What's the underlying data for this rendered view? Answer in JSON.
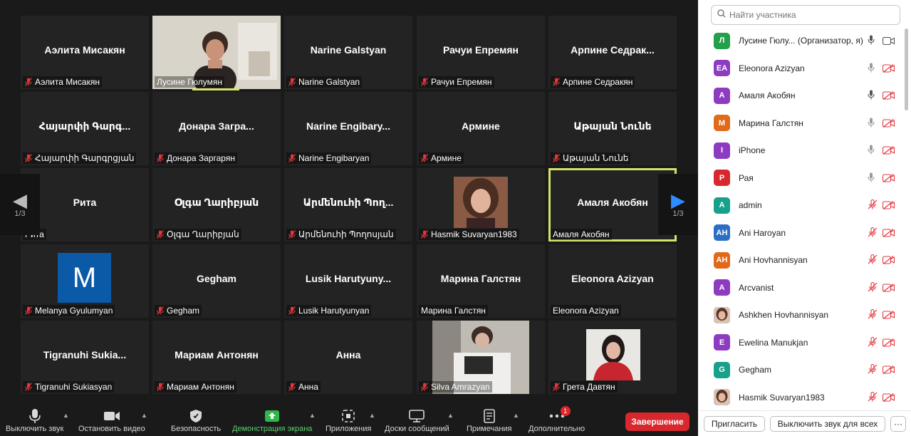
{
  "tiles": [
    {
      "big": "Аэлита Мисакян",
      "label": "Аэлита Мисакян",
      "muted": true
    },
    {
      "big": "",
      "label": "Лусине Гюлумян",
      "muted": false,
      "video": "woman-room"
    },
    {
      "big": "Narine Galstyan",
      "label": "Narine Galstyan",
      "muted": true
    },
    {
      "big": "Рачуи Епремян",
      "label": "Рачуи Епремян",
      "muted": true
    },
    {
      "big": "Арпине Седрак...",
      "label": "Арпине Седракян",
      "muted": true
    },
    {
      "big": "Հայարփի Գարգ...",
      "label": "Հայարփի Գարգրցյան",
      "muted": true
    },
    {
      "big": "Донара Загра...",
      "label": "Донара Заргарян",
      "muted": true
    },
    {
      "big": "Narine Engibary...",
      "label": "Narine Engibaryan",
      "muted": true
    },
    {
      "big": "Армине",
      "label": "Армине",
      "muted": true
    },
    {
      "big": "Աթայան Նունե",
      "label": "Աթայան Նունե",
      "muted": true
    },
    {
      "big": "Рита",
      "label": "Рита",
      "muted": false
    },
    {
      "big": "Օլգա Ղարիբյան",
      "label": "Օլգա Ղարիբյան",
      "muted": true
    },
    {
      "big": "Արմենուհի Պող...",
      "label": "Արմենուհի Պողոսյան",
      "muted": true
    },
    {
      "big": "",
      "label": "Hasmik Suvaryan1983",
      "muted": true,
      "video": "portrait"
    },
    {
      "big": "Амаля Акобян",
      "label": "Амаля Акобян",
      "muted": false,
      "active": true
    },
    {
      "big": "",
      "label": "Melanya Gyulumyan",
      "muted": true,
      "avatar": "M"
    },
    {
      "big": "Gegham",
      "label": "Gegham",
      "muted": true
    },
    {
      "big": "Lusik Harutyuny...",
      "label": "Lusik Harutyunyan",
      "muted": true
    },
    {
      "big": "Марина Галстян",
      "label": "Марина Галстян",
      "muted": false
    },
    {
      "big": "Eleonora Azizyan",
      "label": "Eleonora Azizyan",
      "muted": false
    },
    {
      "big": "Tigranuhi Sukia...",
      "label": "Tigranuhi Sukiasyan",
      "muted": true
    },
    {
      "big": "Мариам Антонян",
      "label": "Мариам Антонян",
      "muted": true
    },
    {
      "big": "Анна",
      "label": "Анна",
      "muted": true
    },
    {
      "big": "",
      "label": "Silva Amrazyan",
      "muted": true,
      "video": "desk"
    },
    {
      "big": "",
      "label": "Грета Давтян",
      "muted": true,
      "video": "red"
    }
  ],
  "pager": {
    "left": "1/3",
    "right": "1/3"
  },
  "toolbar": {
    "mute": "Выключить звук",
    "video": "Остановить видео",
    "security": "Безопасность",
    "share": "Демонстрация экрана",
    "apps": "Приложения",
    "whiteboards": "Доски сообщений",
    "notes": "Примечания",
    "more": "Дополнительно",
    "more_badge": "1",
    "end": "Завершение"
  },
  "panel": {
    "search_placeholder": "Найти участника",
    "invite": "Пригласить",
    "mute_all": "Выключить звук для всех",
    "more": "···"
  },
  "participants": [
    {
      "initials": "Л",
      "color": "#22a04a",
      "name": "Лусине Гюлу...  (Организатор, я)",
      "mic": "on",
      "cam": "on"
    },
    {
      "initials": "EA",
      "color": "#8d3bc1",
      "name": "Eleonora Azizyan",
      "mic": "on-gray",
      "cam": "off"
    },
    {
      "initials": "A",
      "color": "#8d3bc1",
      "name": "Амаля Акобян",
      "mic": "on",
      "cam": "off"
    },
    {
      "initials": "M",
      "color": "#e06a1a",
      "name": "Марина Галстян",
      "mic": "on-gray",
      "cam": "off"
    },
    {
      "initials": "I",
      "color": "#8d3bc1",
      "name": "iPhone",
      "mic": "on-gray",
      "cam": "off"
    },
    {
      "initials": "P",
      "color": "#d8282e",
      "name": "Рая",
      "mic": "on-gray",
      "cam": "off"
    },
    {
      "initials": "A",
      "color": "#18a08a",
      "name": "admin",
      "mic": "off",
      "cam": "off"
    },
    {
      "initials": "AH",
      "color": "#2a6fc4",
      "name": "Ani Haroyan",
      "mic": "off",
      "cam": "off"
    },
    {
      "initials": "AH",
      "color": "#e06a1a",
      "name": "Ani Hovhannisyan",
      "mic": "off",
      "cam": "off"
    },
    {
      "initials": "A",
      "color": "#8d3bc1",
      "name": "Arcvanist",
      "mic": "off",
      "cam": "off"
    },
    {
      "initials": "",
      "color": "#7a4a3a",
      "name": "Ashkhen Hovhannisyan",
      "mic": "off",
      "cam": "off",
      "photo": true
    },
    {
      "initials": "E",
      "color": "#8d3bc1",
      "name": "Ewelina Manukjan",
      "mic": "off",
      "cam": "off"
    },
    {
      "initials": "G",
      "color": "#18a08a",
      "name": "Gegham",
      "mic": "off",
      "cam": "off"
    },
    {
      "initials": "",
      "color": "#7a4a3a",
      "name": "Hasmik Suvaryan1983",
      "mic": "off",
      "cam": "off",
      "photo": true
    }
  ]
}
